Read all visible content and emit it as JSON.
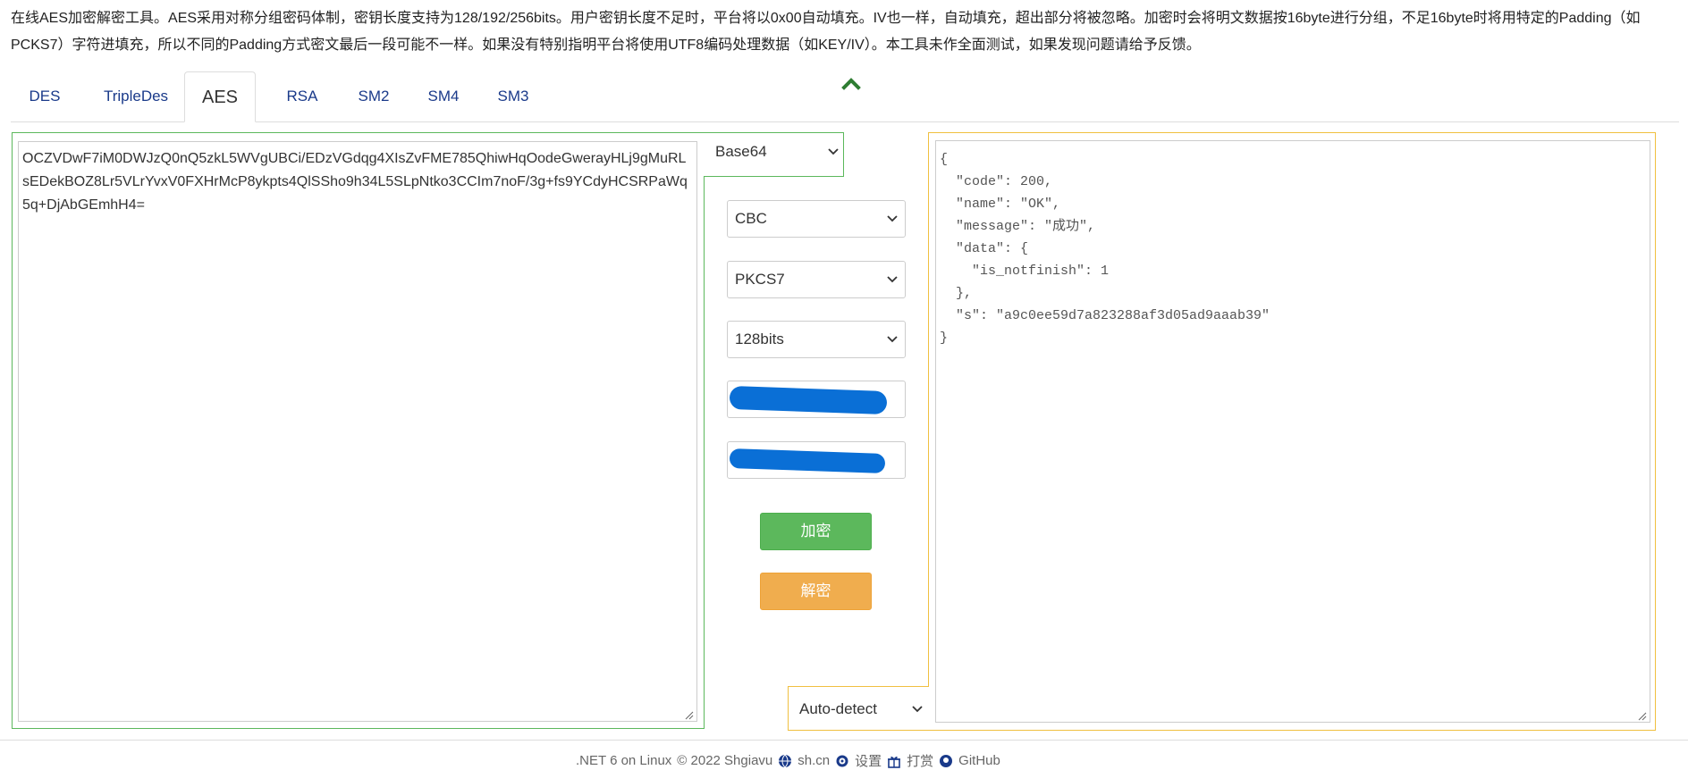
{
  "description": "在线AES加密解密工具。AES采用对称分组密码体制，密钥长度支持为128/192/256bits。用户密钥长度不足时，平台将以0x00自动填充。IV也一样，自动填充，超出部分将被忽略。加密时会将明文数据按16byte进行分组，不足16byte时将用特定的Padding（如PCKS7）字符进填充，所以不同的Padding方式密文最后一段可能不一样。如果没有特别指明平台将使用UTF8编码处理数据（如KEY/IV）。本工具未作全面测试，如果发现问题请给予反馈。",
  "tabs": [
    {
      "label": "DES"
    },
    {
      "label": "TripleDes"
    },
    {
      "label": "AES"
    },
    {
      "label": "RSA"
    },
    {
      "label": "SM2"
    },
    {
      "label": "SM4"
    },
    {
      "label": "SM3"
    }
  ],
  "active_tab": "AES",
  "input_text": "OCZVDwF7iM0DWJzQ0nQ5zkL5WVgUBCi/EDzVGdqg4XIsZvFME785QhiwHqOodeGwerayHLj9gMuRLsEDekBOZ8Lr5VLrYvxV0FXHrMcP8ykpts4QlSSho9h34L5SLpNtko3CCIm7noF/3g+fs9YCdyHCSRPaWq5q+DjAbGEmhH4=",
  "input_encoding": "Base64",
  "mode": "CBC",
  "padding": "PKCS7",
  "key_size": "128bits",
  "encrypt_label": "加密",
  "decrypt_label": "解密",
  "output_encoding": "Auto-detect",
  "output_text": "{\n  \"code\": 200,\n  \"name\": \"OK\",\n  \"message\": \"成功\",\n  \"data\": {\n    \"is_notfinish\": 1\n  },\n  \"s\": \"a9c0ee59d7a823288af3d05ad9aaab39\"\n}",
  "footer": {
    "platform": ".NET 6 on Linux",
    "copyright": "© 2022 Shgiavu",
    "site": "sh.cn",
    "settings": "设置",
    "donate": "打赏",
    "github": "GitHub"
  },
  "colors": {
    "green": "#5cb85c",
    "orange": "#f0ad4e",
    "redaction": "#0a6fd6",
    "tab_link": "#1a3a8a"
  }
}
